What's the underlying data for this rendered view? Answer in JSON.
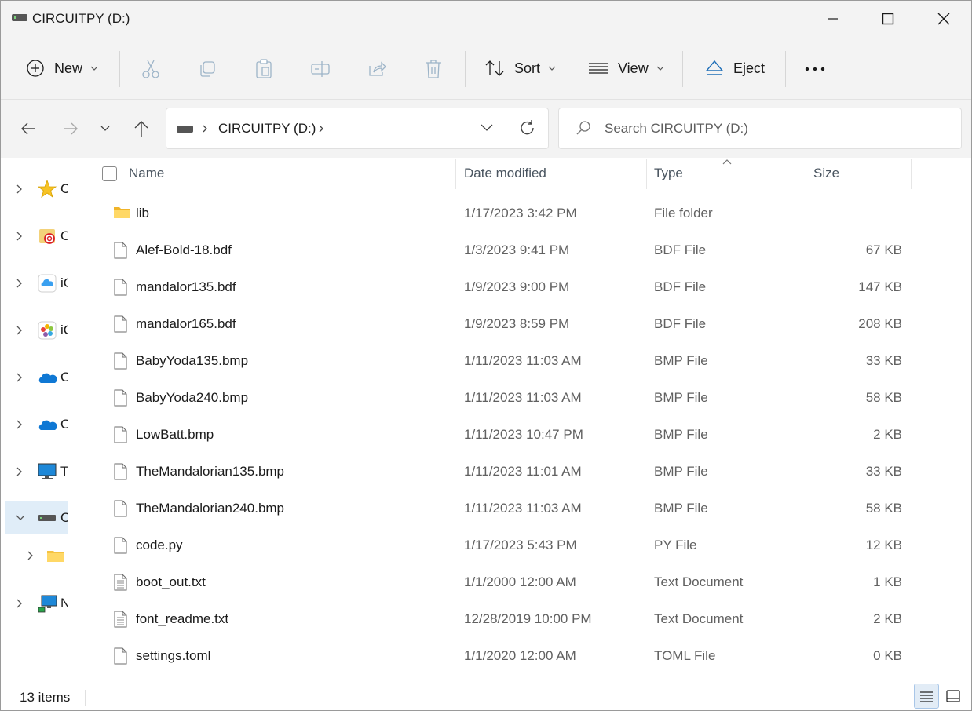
{
  "window": {
    "title": "CIRCUITPY (D:)"
  },
  "toolbar": {
    "new_label": "New",
    "sort_label": "Sort",
    "view_label": "View",
    "eject_label": "Eject"
  },
  "address": {
    "path": "CIRCUITPY (D:)",
    "search_placeholder": "Search CIRCUITPY (D:)"
  },
  "nav": {
    "items": [
      {
        "label": "C",
        "icon": "star-icon"
      },
      {
        "label": "C",
        "icon": "creative-cloud-folder-icon"
      },
      {
        "label": "iC",
        "icon": "icloud-drive-icon"
      },
      {
        "label": "iC",
        "icon": "icloud-photos-icon"
      },
      {
        "label": "C",
        "icon": "onedrive-icon"
      },
      {
        "label": "C",
        "icon": "onedrive-icon"
      },
      {
        "label": "T",
        "icon": "this-pc-icon"
      },
      {
        "label": "C",
        "icon": "drive-icon"
      },
      {
        "label": "",
        "icon": "folder-icon"
      },
      {
        "label": "N",
        "icon": "network-icon"
      }
    ]
  },
  "columns": {
    "name": "Name",
    "date": "Date modified",
    "type": "Type",
    "size": "Size"
  },
  "files": [
    {
      "name": "lib",
      "date": "1/17/2023 3:42 PM",
      "type": "File folder",
      "size": "",
      "kind": "folder"
    },
    {
      "name": "Alef-Bold-18.bdf",
      "date": "1/3/2023 9:41 PM",
      "type": "BDF File",
      "size": "67 KB",
      "kind": "file"
    },
    {
      "name": "mandalor135.bdf",
      "date": "1/9/2023 9:00 PM",
      "type": "BDF File",
      "size": "147 KB",
      "kind": "file"
    },
    {
      "name": "mandalor165.bdf",
      "date": "1/9/2023 8:59 PM",
      "type": "BDF File",
      "size": "208 KB",
      "kind": "file"
    },
    {
      "name": "BabyYoda135.bmp",
      "date": "1/11/2023 11:03 AM",
      "type": "BMP File",
      "size": "33 KB",
      "kind": "file"
    },
    {
      "name": "BabyYoda240.bmp",
      "date": "1/11/2023 11:03 AM",
      "type": "BMP File",
      "size": "58 KB",
      "kind": "file"
    },
    {
      "name": "LowBatt.bmp",
      "date": "1/11/2023 10:47 PM",
      "type": "BMP File",
      "size": "2 KB",
      "kind": "file"
    },
    {
      "name": "TheMandalorian135.bmp",
      "date": "1/11/2023 11:01 AM",
      "type": "BMP File",
      "size": "33 KB",
      "kind": "file"
    },
    {
      "name": "TheMandalorian240.bmp",
      "date": "1/11/2023 11:03 AM",
      "type": "BMP File",
      "size": "58 KB",
      "kind": "file"
    },
    {
      "name": "code.py",
      "date": "1/17/2023 5:43 PM",
      "type": "PY File",
      "size": "12 KB",
      "kind": "file"
    },
    {
      "name": "boot_out.txt",
      "date": "1/1/2000 12:00 AM",
      "type": "Text Document",
      "size": "1 KB",
      "kind": "text"
    },
    {
      "name": "font_readme.txt",
      "date": "12/28/2019 10:00 PM",
      "type": "Text Document",
      "size": "2 KB",
      "kind": "text"
    },
    {
      "name": "settings.toml",
      "date": "1/1/2020 12:00 AM",
      "type": "TOML File",
      "size": "0 KB",
      "kind": "file"
    }
  ],
  "status": {
    "items": "13 items"
  }
}
